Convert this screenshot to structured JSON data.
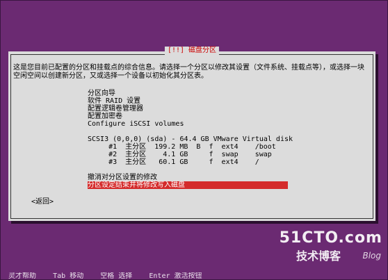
{
  "dialog": {
    "title": "[!!] 磁盘分区",
    "description": "这是您目前已配置的分区和挂载点的综合信息。请选择一个分区以修改其设置（文件系统、挂载点等），或选择一块空闲空间以创建新分区，又或选择一个设备以初始化其分区表。",
    "menu": {
      "guided": "分区向导",
      "raid": "软件 RAID 设置",
      "lvm": "配置逻辑卷管理器",
      "crypto": "配置加密卷",
      "iscsi": "Configure iSCSI volumes",
      "disk": "SCSI3 (0,0,0) (sda) - 64.4 GB VMware Virtual disk",
      "partitions": [
        {
          "text": "     #1  主分区  199.2 MB  B  f  ext4    /boot"
        },
        {
          "text": "     #2  主分区    4.1 GB     f  swap    swap"
        },
        {
          "text": "     #3  主分区   60.1 GB     f  ext4    /"
        }
      ],
      "undo": "撤消对分区设置的修改",
      "finish": "分区设定结束并将修改写入磁盘"
    },
    "back_label": "<返回>"
  },
  "watermark": {
    "site": "51CTO.com",
    "tagline": "技术博客",
    "blog": "Blog"
  },
  "bottom_text": "  灵才帮助    Tab 移动    空格 选择    Enter 激活按钮"
}
